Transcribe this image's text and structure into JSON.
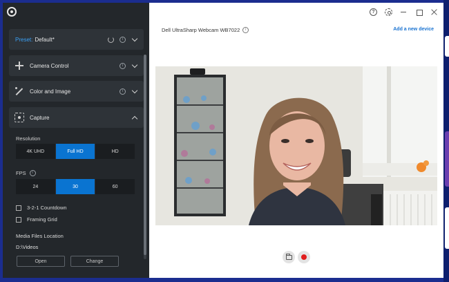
{
  "sidebar": {
    "preset": {
      "label": "Preset:",
      "value": "Default*"
    },
    "panels": {
      "camera_control": {
        "title": "Camera Control"
      },
      "color_image": {
        "title": "Color and Image"
      },
      "capture": {
        "title": "Capture"
      }
    },
    "capture": {
      "resolution_label": "Resolution",
      "resolution_options": [
        "4K UHD",
        "Full HD",
        "HD"
      ],
      "resolution_selected": "Full HD",
      "fps_label": "FPS",
      "fps_options": [
        "24",
        "30",
        "60"
      ],
      "fps_selected": "30",
      "countdown_label": "3-2-1 Countdown",
      "countdown_checked": false,
      "framing_grid_label": "Framing Grid",
      "framing_grid_checked": false,
      "media_location_label": "Media Files Location",
      "media_path": "D:\\Videos",
      "open_button": "Open",
      "change_button": "Change"
    }
  },
  "main": {
    "device_name": "Dell UltraSharp Webcam WB7022",
    "add_device": "Add a new device"
  },
  "colors": {
    "accent": "#0a74d1",
    "link": "#1a73d1",
    "preset_label": "#3aa0f5",
    "record": "#e01e1e",
    "sidebar_bg": "#23272b"
  },
  "icons": [
    "app-logo-icon",
    "refresh-icon",
    "info-icon",
    "chevron-down-icon",
    "chevron-up-icon",
    "crosshair-icon",
    "magic-wand-icon",
    "capture-icon",
    "help-icon",
    "gear-icon",
    "minimize-icon",
    "maximize-icon",
    "close-icon",
    "folder-icon",
    "record-icon"
  ]
}
